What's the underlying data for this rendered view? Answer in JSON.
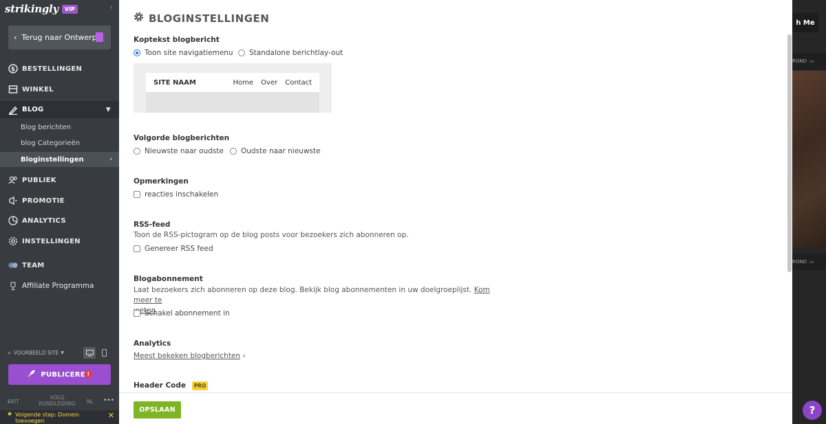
{
  "sidebar": {
    "logo": "strikingly",
    "vip_badge": "VIP",
    "back_button": "Terug naar Ontwerp",
    "nav": {
      "orders": "BESTELLINGEN",
      "store": "WINKEL",
      "blog": "BLOG",
      "blog_posts": "Blog berichten",
      "blog_categories": "blog Categorieën",
      "blog_settings": "Bloginstellingen",
      "audience": "PUBLIEK",
      "promotion": "PROMOTIE",
      "analytics": "ANALYTICS",
      "settings": "INSTELLINGEN",
      "team": "TEAM",
      "affiliate": "Affiliate Programma"
    },
    "preview_site": "VOORBEELD SITE",
    "publish": "PUBLICEREN",
    "publish_alert": "!",
    "footer": {
      "exit": "EXIT",
      "tour": "VOLG RONDLEIDING",
      "lang": "NL",
      "more": "•••"
    },
    "next_step": "Volgende stap: Domein toevoegen"
  },
  "panel": {
    "title": "BLOGINSTELLINGEN",
    "header_text": {
      "label": "Koptekst blogbericht",
      "option1": "Toon site navigatiemenu",
      "option2": "Standalone berichtlay-out",
      "selected": 1
    },
    "mock_nav": {
      "site_name": "SITE NAAM",
      "links": [
        "Home",
        "Over",
        "Contact"
      ]
    },
    "order": {
      "label": "Volgorde blogberichten",
      "option1": "Nieuwste naar oudste",
      "option2": "Oudste naar nieuwste"
    },
    "comments": {
      "label": "Opmerkingen",
      "option": "reacties inschakelen"
    },
    "rss": {
      "label": "RSS-feed",
      "description": "Toon de RSS-pictogram op de blog posts voor bezoekers zich abonneren op.",
      "option": "Genereer RSS feed"
    },
    "subscription": {
      "label": "Blogabonnement",
      "description": "Laat bezoekers zich abonneren op deze blog. Bekijk blog abonnementen in uw doelgroeplijst.",
      "link_part1": "Kom meer te",
      "link_part2": "weten",
      "option": "Schakel abonnement in"
    },
    "analytics": {
      "label": "Analytics",
      "link": "Meest bekeken blogberichten"
    },
    "header_code": {
      "label": "Header Code",
      "badge": "PRO"
    },
    "save_button": "OPSLAAN"
  },
  "preview": {
    "touch_button": "h Me",
    "background_label_1": "ROND",
    "background_label_2": "ROND",
    "help": "?"
  }
}
